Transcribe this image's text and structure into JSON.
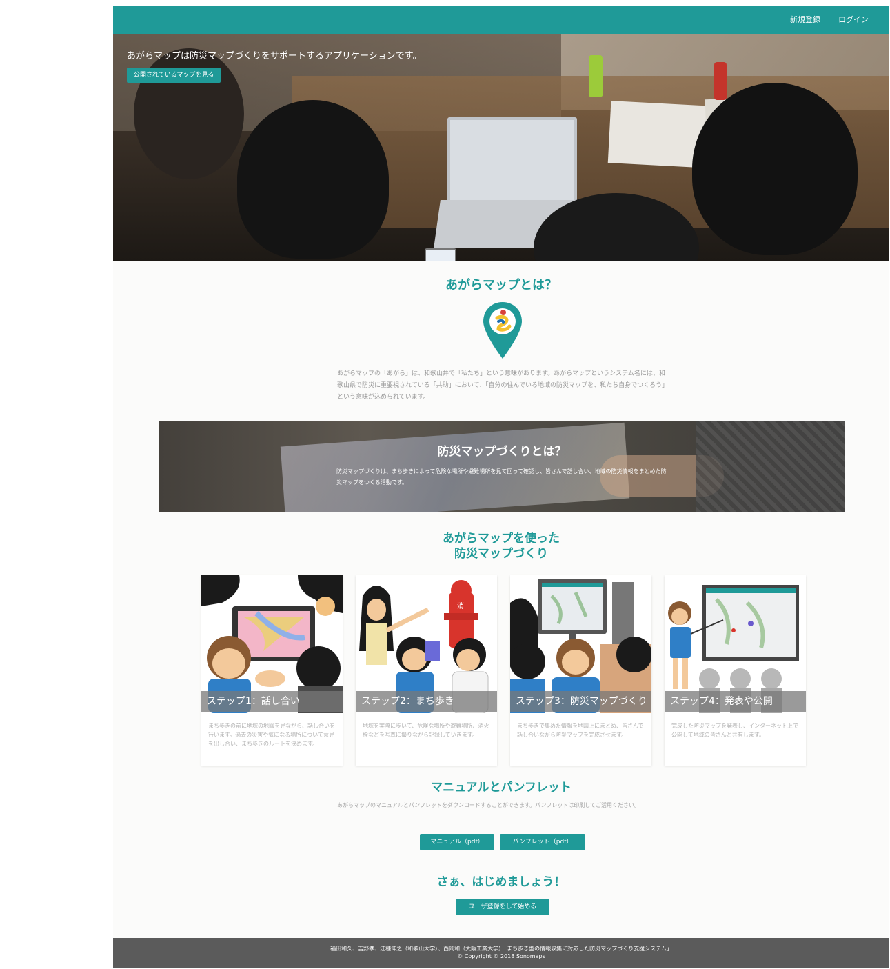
{
  "nav": {
    "register": "新規登録",
    "login": "ログイン"
  },
  "hero": {
    "title": "あがらマップは防災マップづくりをサポートするアプリケーションです。",
    "button": "公開されているマップを見る"
  },
  "about": {
    "title": "あがらマップとは？",
    "text": "あがらマップの「あがら」は、和歌山弁で「私たち」という意味があります。あがらマップというシステム名には、和歌山県で防災に重要視されている「共助」において、「自分の住んでいる地域の防災マップを、私たち自身でつくろう」という意味が込められています。"
  },
  "banner": {
    "title": "防災マップづくりとは？",
    "text": "防災マップづくりは、まち歩きによって危険な場所や避難場所を見て回って確認し、皆さんで話し合い、地域の防災情報をまとめた防災マップをつくる活動です。"
  },
  "steps": {
    "title_line1": "あがらマップを使った",
    "title_line2": "防災マップづくり",
    "items": [
      {
        "label": "ステップ1：話し合い",
        "desc": "まち歩きの前に地域の地図を見ながら、話し合いを行います。過去の災害や気になる場所について意見を出し合い、まち歩きのルートを決めます。"
      },
      {
        "label": "ステップ2：まち歩き",
        "desc": "地域を実際に歩いて、危険な場所や避難場所、消火栓などを写真に撮りながら記録していきます。"
      },
      {
        "label": "ステップ3：防災マップづくり",
        "desc": "まち歩きで集めた情報を地図上にまとめ、皆さんで話し合いながら防災マップを完成させます。"
      },
      {
        "label": "ステップ4：発表や公開",
        "desc": "完成した防災マップを発表し、インターネット上で公開して地域の皆さんと共有します。"
      }
    ]
  },
  "manual": {
    "title": "マニュアルとパンフレット",
    "text": "あがらマップのマニュアルとパンフレットをダウンロードすることができます。パンフレットは印刷してご活用ください。",
    "button_manual": "マニュアル（pdf）",
    "button_pamphlet": "パンフレット（pdf）"
  },
  "start": {
    "title": "さぁ、はじめましょう！",
    "button": "ユーザ登録をして始める"
  },
  "footer": {
    "line1": "福田和久、吉野孝、江種伸之（和歌山大学）、西岡和（大阪工業大学）「まち歩き型の情報収集に対応した防災マップづくり支援システム」",
    "line2": "© Copyright © 2018 Sonomaps"
  },
  "colors": {
    "accent": "#1f9a98",
    "footer": "#5b5b5b"
  }
}
